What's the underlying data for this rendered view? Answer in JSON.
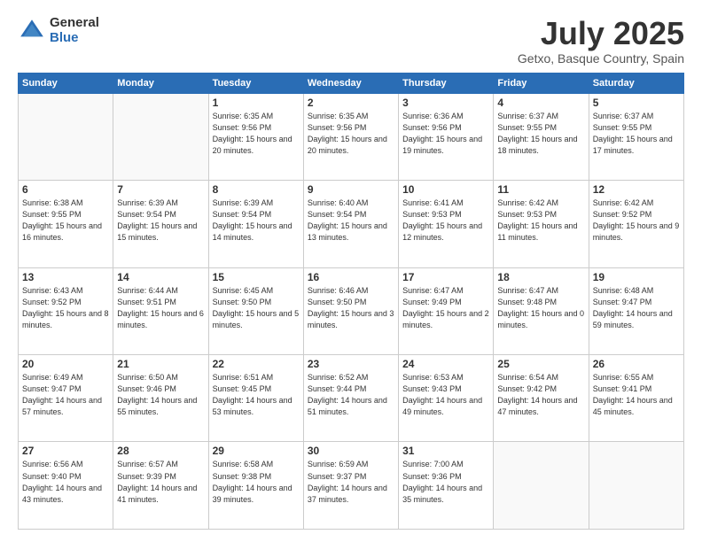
{
  "logo": {
    "general": "General",
    "blue": "Blue"
  },
  "title": "July 2025",
  "subtitle": "Getxo, Basque Country, Spain",
  "weekdays": [
    "Sunday",
    "Monday",
    "Tuesday",
    "Wednesday",
    "Thursday",
    "Friday",
    "Saturday"
  ],
  "weeks": [
    [
      {
        "day": "",
        "info": ""
      },
      {
        "day": "",
        "info": ""
      },
      {
        "day": "1",
        "info": "Sunrise: 6:35 AM\nSunset: 9:56 PM\nDaylight: 15 hours\nand 20 minutes."
      },
      {
        "day": "2",
        "info": "Sunrise: 6:35 AM\nSunset: 9:56 PM\nDaylight: 15 hours\nand 20 minutes."
      },
      {
        "day": "3",
        "info": "Sunrise: 6:36 AM\nSunset: 9:56 PM\nDaylight: 15 hours\nand 19 minutes."
      },
      {
        "day": "4",
        "info": "Sunrise: 6:37 AM\nSunset: 9:55 PM\nDaylight: 15 hours\nand 18 minutes."
      },
      {
        "day": "5",
        "info": "Sunrise: 6:37 AM\nSunset: 9:55 PM\nDaylight: 15 hours\nand 17 minutes."
      }
    ],
    [
      {
        "day": "6",
        "info": "Sunrise: 6:38 AM\nSunset: 9:55 PM\nDaylight: 15 hours\nand 16 minutes."
      },
      {
        "day": "7",
        "info": "Sunrise: 6:39 AM\nSunset: 9:54 PM\nDaylight: 15 hours\nand 15 minutes."
      },
      {
        "day": "8",
        "info": "Sunrise: 6:39 AM\nSunset: 9:54 PM\nDaylight: 15 hours\nand 14 minutes."
      },
      {
        "day": "9",
        "info": "Sunrise: 6:40 AM\nSunset: 9:54 PM\nDaylight: 15 hours\nand 13 minutes."
      },
      {
        "day": "10",
        "info": "Sunrise: 6:41 AM\nSunset: 9:53 PM\nDaylight: 15 hours\nand 12 minutes."
      },
      {
        "day": "11",
        "info": "Sunrise: 6:42 AM\nSunset: 9:53 PM\nDaylight: 15 hours\nand 11 minutes."
      },
      {
        "day": "12",
        "info": "Sunrise: 6:42 AM\nSunset: 9:52 PM\nDaylight: 15 hours\nand 9 minutes."
      }
    ],
    [
      {
        "day": "13",
        "info": "Sunrise: 6:43 AM\nSunset: 9:52 PM\nDaylight: 15 hours\nand 8 minutes."
      },
      {
        "day": "14",
        "info": "Sunrise: 6:44 AM\nSunset: 9:51 PM\nDaylight: 15 hours\nand 6 minutes."
      },
      {
        "day": "15",
        "info": "Sunrise: 6:45 AM\nSunset: 9:50 PM\nDaylight: 15 hours\nand 5 minutes."
      },
      {
        "day": "16",
        "info": "Sunrise: 6:46 AM\nSunset: 9:50 PM\nDaylight: 15 hours\nand 3 minutes."
      },
      {
        "day": "17",
        "info": "Sunrise: 6:47 AM\nSunset: 9:49 PM\nDaylight: 15 hours\nand 2 minutes."
      },
      {
        "day": "18",
        "info": "Sunrise: 6:47 AM\nSunset: 9:48 PM\nDaylight: 15 hours\nand 0 minutes."
      },
      {
        "day": "19",
        "info": "Sunrise: 6:48 AM\nSunset: 9:47 PM\nDaylight: 14 hours\nand 59 minutes."
      }
    ],
    [
      {
        "day": "20",
        "info": "Sunrise: 6:49 AM\nSunset: 9:47 PM\nDaylight: 14 hours\nand 57 minutes."
      },
      {
        "day": "21",
        "info": "Sunrise: 6:50 AM\nSunset: 9:46 PM\nDaylight: 14 hours\nand 55 minutes."
      },
      {
        "day": "22",
        "info": "Sunrise: 6:51 AM\nSunset: 9:45 PM\nDaylight: 14 hours\nand 53 minutes."
      },
      {
        "day": "23",
        "info": "Sunrise: 6:52 AM\nSunset: 9:44 PM\nDaylight: 14 hours\nand 51 minutes."
      },
      {
        "day": "24",
        "info": "Sunrise: 6:53 AM\nSunset: 9:43 PM\nDaylight: 14 hours\nand 49 minutes."
      },
      {
        "day": "25",
        "info": "Sunrise: 6:54 AM\nSunset: 9:42 PM\nDaylight: 14 hours\nand 47 minutes."
      },
      {
        "day": "26",
        "info": "Sunrise: 6:55 AM\nSunset: 9:41 PM\nDaylight: 14 hours\nand 45 minutes."
      }
    ],
    [
      {
        "day": "27",
        "info": "Sunrise: 6:56 AM\nSunset: 9:40 PM\nDaylight: 14 hours\nand 43 minutes."
      },
      {
        "day": "28",
        "info": "Sunrise: 6:57 AM\nSunset: 9:39 PM\nDaylight: 14 hours\nand 41 minutes."
      },
      {
        "day": "29",
        "info": "Sunrise: 6:58 AM\nSunset: 9:38 PM\nDaylight: 14 hours\nand 39 minutes."
      },
      {
        "day": "30",
        "info": "Sunrise: 6:59 AM\nSunset: 9:37 PM\nDaylight: 14 hours\nand 37 minutes."
      },
      {
        "day": "31",
        "info": "Sunrise: 7:00 AM\nSunset: 9:36 PM\nDaylight: 14 hours\nand 35 minutes."
      },
      {
        "day": "",
        "info": ""
      },
      {
        "day": "",
        "info": ""
      }
    ]
  ]
}
